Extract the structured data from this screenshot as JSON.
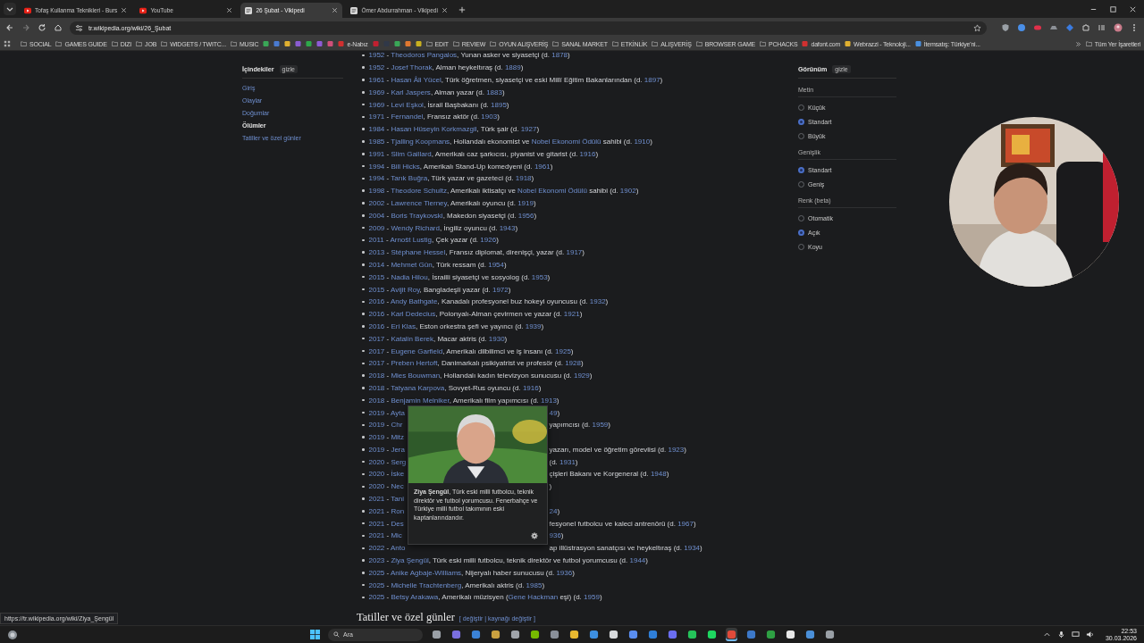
{
  "browser": {
    "tabs": [
      {
        "title": "Tofaş Kullanma Teknikleri - Burs",
        "kind": "video",
        "selected": false
      },
      {
        "title": "YouTube",
        "kind": "video",
        "selected": false
      },
      {
        "title": "26 Şubat - Vikipedi",
        "kind": "wiki",
        "selected": true
      },
      {
        "title": "Ömer Abdurrahman - Vikipedi",
        "kind": "wiki",
        "selected": false
      }
    ],
    "url": "tr.wikipedia.org/wiki/26_Şubat",
    "bookmarks": [
      {
        "kind": "folder",
        "label": "SOCIAL"
      },
      {
        "kind": "folder",
        "label": "GAMES GUIDE"
      },
      {
        "kind": "folder",
        "label": "DIZI"
      },
      {
        "kind": "folder",
        "label": "JOB"
      },
      {
        "kind": "folder",
        "label": "WIDGETS / TWITC..."
      },
      {
        "kind": "folder",
        "label": "MUSIC"
      },
      {
        "kind": "site",
        "color": "#3aa757"
      },
      {
        "kind": "site",
        "color": "#4a7bd0"
      },
      {
        "kind": "site",
        "color": "#e0b030"
      },
      {
        "kind": "site",
        "color": "#8a5cd0"
      },
      {
        "kind": "site",
        "color": "#2ea84a"
      },
      {
        "kind": "site",
        "color": "#8e5bd6"
      },
      {
        "kind": "site",
        "color": "#d0507a"
      },
      {
        "kind": "site",
        "color": "#d03030",
        "label": "e-Nabız"
      },
      {
        "kind": "site",
        "color": "#c02030"
      },
      {
        "kind": "site",
        "color": "#303848"
      },
      {
        "kind": "site",
        "color": "#3aa757"
      },
      {
        "kind": "site",
        "color": "#e07830"
      },
      {
        "kind": "site",
        "color": "#c8b020"
      },
      {
        "kind": "folder",
        "label": "EDIT"
      },
      {
        "kind": "folder",
        "label": "REVIEW"
      },
      {
        "kind": "folder",
        "label": "OYUN ALIŞVERİŞ"
      },
      {
        "kind": "folder",
        "label": "SANAL MARKET"
      },
      {
        "kind": "folder",
        "label": "ETKİNLİK"
      },
      {
        "kind": "folder",
        "label": "ALIŞVERİŞ"
      },
      {
        "kind": "folder",
        "label": "BROWSER GAME"
      },
      {
        "kind": "folder",
        "label": "PCHACKS"
      },
      {
        "kind": "site",
        "color": "#d03030",
        "label": "dafont.com"
      },
      {
        "kind": "site",
        "color": "#e0b030",
        "label": "Webrazzi - Teknoloji..."
      },
      {
        "kind": "site",
        "color": "#4a90e0",
        "label": "İtemsatış: Türkiye'ni..."
      }
    ],
    "all_bookmarks": "Tüm Yer İşaretleri"
  },
  "toc": {
    "title": "İçindekiler",
    "hide": "gizle",
    "items": [
      {
        "label": "Giriş",
        "selected": false
      },
      {
        "label": "Olaylar",
        "selected": false
      },
      {
        "label": "Doğumlar",
        "selected": false
      },
      {
        "label": "Ölümler",
        "selected": true
      },
      {
        "label": "Tatiller ve özel günler",
        "selected": false
      }
    ]
  },
  "deaths": [
    {
      "segs": [
        "1952",
        " - ",
        "Theodoros Pangalos",
        ", Yunan asker ve siyasetçi (d. ",
        "1878",
        ")"
      ]
    },
    {
      "segs": [
        "1952",
        " - ",
        "Josef Thorak",
        ", Alman heykeltıraş (d. ",
        "1889",
        ")"
      ]
    },
    {
      "segs": [
        "1961",
        " - ",
        "Hasan Âli Yücel",
        ", Türk öğretmen, siyasetçi ve eski Millî Eğitim Bakanlarından (d. ",
        "1897",
        ")"
      ]
    },
    {
      "segs": [
        "1969",
        " - ",
        "Karl Jaspers",
        ", Alman yazar (d. ",
        "1883",
        ")"
      ]
    },
    {
      "segs": [
        "1969",
        " - ",
        "Levi Eşkol",
        ", İsrail Başbakanı (d. ",
        "1895",
        ")"
      ]
    },
    {
      "segs": [
        "1971",
        " - ",
        "Fernandel",
        ", Fransız aktör (d. ",
        "1903",
        ")"
      ]
    },
    {
      "segs": [
        "1984",
        " - ",
        "Hasan Hüseyin Korkmazgil",
        ", Türk şair (d. ",
        "1927",
        ")"
      ]
    },
    {
      "segs": [
        "1985",
        " - ",
        "Tjalling Koopmans",
        ", Hollandalı ekonomist ve ",
        "Nobel Ekonomi Ödülü",
        " sahibi (d. ",
        "1910",
        ")"
      ]
    },
    {
      "segs": [
        "1991",
        " - ",
        "Slim Gaillard",
        ", Amerikalı caz şarkıcısı, piyanist ve gitarist (d. ",
        "1916",
        ")"
      ]
    },
    {
      "segs": [
        "1994",
        " - ",
        "Bill Hicks",
        ", Amerikalı Stand-Up komedyeni (d. ",
        "1961",
        ")"
      ]
    },
    {
      "segs": [
        "1994",
        " - ",
        "Tarık Buğra",
        ", Türk yazar ve gazeteci (d. ",
        "1918",
        ")"
      ]
    },
    {
      "segs": [
        "1998",
        " - ",
        "Theodore Schultz",
        ", Amerikalı iktisatçı ve ",
        "Nobel Ekonomi Ödülü",
        " sahibi (d. ",
        "1902",
        ")"
      ]
    },
    {
      "segs": [
        "2002",
        " - ",
        "Lawrence Tierney",
        ", Amerikalı oyuncu (d. ",
        "1919",
        ")"
      ]
    },
    {
      "segs": [
        "2004",
        " - ",
        "Boris Traykovski",
        ", Makedon siyasetçi (d. ",
        "1956",
        ")"
      ]
    },
    {
      "segs": [
        "2009",
        " - ",
        "Wendy Richard",
        ", İngiliz oyuncu (d. ",
        "1943",
        ")"
      ]
    },
    {
      "segs": [
        "2011",
        " - ",
        "Arnošt Lustig",
        ", Çek yazar (d. ",
        "1926",
        ")"
      ]
    },
    {
      "segs": [
        "2013",
        " - ",
        "Stéphane Hessel",
        ", Fransız diplomat, direnişçi, yazar (d. ",
        "1917",
        ")"
      ]
    },
    {
      "segs": [
        "2014",
        " - ",
        "Mehmet Gün",
        ", Türk ressam (d. ",
        "1954",
        ")"
      ]
    },
    {
      "segs": [
        "2015",
        " - ",
        "Nadia Hilou",
        ", İsrailli siyasetçi ve sosyolog (d. ",
        "1953",
        ")"
      ]
    },
    {
      "segs": [
        "2015",
        " - ",
        "Avijit Roy",
        ", Bangladeşli yazar (d. ",
        "1972",
        ")"
      ]
    },
    {
      "segs": [
        "2016",
        " - ",
        "Andy Bathgate",
        ", Kanadalı profesyonel buz hokeyi oyuncusu (d. ",
        "1932",
        ")"
      ]
    },
    {
      "segs": [
        "2016",
        " - ",
        "Karl Dedecius",
        ", Polonyalı-Alman çevirmen ve yazar (d. ",
        "1921",
        ")"
      ]
    },
    {
      "segs": [
        "2016",
        " - ",
        "Eri Klas",
        ", Eston orkestra şefi ve yayıncı (d. ",
        "1939",
        ")"
      ]
    },
    {
      "segs": [
        "2017",
        " - ",
        "Katalin Berek",
        ", Macar aktris (d. ",
        "1930",
        ")"
      ]
    },
    {
      "segs": [
        "2017",
        " - ",
        "Eugene Garfield",
        ", Amerikalı dilbilimci ve iş insanı (d. ",
        "1925",
        ")"
      ]
    },
    {
      "segs": [
        "2017",
        " - ",
        "Preben Hertoft",
        ", Danimarkalı psikiyatrist ve profesör (d. ",
        "1928",
        ")"
      ]
    },
    {
      "segs": [
        "2018",
        " - ",
        "Mies Bouwman",
        ", Hollandalı kadın televizyon sunucusu (d. ",
        "1929",
        ")"
      ]
    },
    {
      "segs": [
        "2018",
        " - ",
        "Tatyana Karpova",
        ", Sovyet-Rus oyuncu (d. ",
        "1916",
        ")"
      ]
    },
    {
      "segs": [
        "2018",
        " - ",
        "Benjamin Melniker",
        ", Amerikalı film yapımcısı (d. ",
        "1913",
        ")"
      ]
    },
    {
      "segs": [
        "2019",
        " - ",
        "Ayta"
      ],
      "after": [
        {
          "text": "49",
          "link": true
        },
        {
          "text": ")",
          "link": false
        }
      ]
    },
    {
      "segs": [
        "2019",
        " - ",
        "Chr"
      ],
      "after": [
        {
          "text": "yapımcısı (d. ",
          "link": false
        },
        {
          "text": "1959",
          "link": true
        },
        {
          "text": ")",
          "link": false
        }
      ]
    },
    {
      "segs": [
        "2019",
        " - ",
        "Mitz"
      ]
    },
    {
      "segs": [
        "2019",
        " - ",
        "Jera"
      ],
      "after": [
        {
          "text": "yazarı, model ve öğretim görevlisi (d. ",
          "link": false
        },
        {
          "text": "1923",
          "link": true
        },
        {
          "text": ")",
          "link": false
        }
      ]
    },
    {
      "segs": [
        "2020",
        " - ",
        "Serg"
      ],
      "after": [
        {
          "text": "(d. ",
          "link": false
        },
        {
          "text": "1931",
          "link": true
        },
        {
          "text": ")",
          "link": false
        }
      ]
    },
    {
      "segs": [
        "2020",
        " - ",
        "İske"
      ],
      "after": [
        {
          "text": "çişleri Bakanı ve Korgeneral (d. ",
          "link": false
        },
        {
          "text": "1948",
          "link": true
        },
        {
          "text": ")",
          "link": false
        }
      ]
    },
    {
      "segs": [
        "2020",
        " - ",
        "Nec"
      ],
      "after": [
        {
          "text": ")",
          "link": false
        }
      ]
    },
    {
      "segs": [
        "2021",
        " - ",
        "Tani"
      ]
    },
    {
      "segs": [
        "2021",
        " - ",
        "Ron"
      ],
      "after": [
        {
          "text": "24",
          "link": true
        },
        {
          "text": ")",
          "link": false
        }
      ]
    },
    {
      "segs": [
        "2021",
        " - ",
        "Des"
      ],
      "after": [
        {
          "text": "fesyonel futbolcu ve kaleci antrenörü (d. ",
          "link": false
        },
        {
          "text": "1967",
          "link": true
        },
        {
          "text": ")",
          "link": false
        }
      ]
    },
    {
      "segs": [
        "2021",
        " - ",
        "Mic"
      ],
      "after": [
        {
          "text": "936",
          "link": true
        },
        {
          "text": ")",
          "link": false
        }
      ]
    },
    {
      "segs": [
        "2022",
        " - ",
        "Anto"
      ],
      "after": [
        {
          "text": "ap illüstrasyon sanatçısı ve heykeltıraş (d. ",
          "link": false
        },
        {
          "text": "1934",
          "link": true
        },
        {
          "text": ")",
          "link": false
        }
      ]
    },
    {
      "segs": [
        "2023",
        " - ",
        "Ziya Şengül",
        ", Türk eski milli futbolcu, teknik direktör ve futbol yorumcusu (d. ",
        "1944",
        ")"
      ]
    },
    {
      "segs": [
        "2025",
        " - ",
        "Anike Agbaje-Williams",
        ", Nijeryalı haber sunucusu (d. ",
        "1936",
        ")"
      ]
    },
    {
      "segs": [
        "2025",
        " - ",
        "Michelle Trachtenberg",
        ", Amerikalı aktris (d. ",
        "1985",
        ")"
      ]
    },
    {
      "segs": [
        "2025",
        " - ",
        "Betsy Arakawa",
        ", Amerikalı müzisyen (",
        "Gene Hackman",
        " eşi) (d. ",
        "1959",
        ")"
      ]
    }
  ],
  "popup": {
    "text": "**Ziya Şengül**, Türk eski milli futbolcu, teknik direktör ve futbol yorumcusu. Fenerbahçe ve Türkiye milli futbol takımının eski kaptanlarındandır."
  },
  "next_heading": {
    "title": "Tatiller ve özel günler",
    "edit_links": "[ değiştir | kaynağı değiştir ]"
  },
  "appearance": {
    "title": "Görünüm",
    "hide": "gizle",
    "groups": [
      {
        "label": "Metin",
        "options": [
          {
            "label": "Küçük",
            "selected": false
          },
          {
            "label": "Standart",
            "selected": true
          },
          {
            "label": "Büyük",
            "selected": false
          }
        ]
      },
      {
        "label": "Genişlik",
        "options": [
          {
            "label": "Standart",
            "selected": true
          },
          {
            "label": "Geniş",
            "selected": false
          }
        ]
      },
      {
        "label": "Renk (beta)",
        "options": [
          {
            "label": "Otomatik",
            "selected": false
          },
          {
            "label": "Açık",
            "selected": true
          },
          {
            "label": "Koyu",
            "selected": false
          }
        ]
      }
    ]
  },
  "status_url": "https://tr.wikipedia.org/wiki/Ziya_Şengül",
  "taskbar": {
    "search_placeholder": "Ara",
    "apps": [
      {
        "color": "#9aa0a6",
        "selected": false
      },
      {
        "color": "#7b6fe0",
        "selected": false
      },
      {
        "color": "#3b82d6",
        "selected": false
      },
      {
        "color": "#c9a040",
        "selected": false
      },
      {
        "color": "#a0a4aa",
        "selected": false
      },
      {
        "color": "#76b900",
        "selected": false
      },
      {
        "color": "#8a9099",
        "selected": false
      },
      {
        "color": "#e8b830",
        "selected": false
      },
      {
        "color": "#3d8fe0",
        "selected": false
      },
      {
        "color": "#d8dadc",
        "selected": false
      },
      {
        "color": "#5a8ef0",
        "selected": false
      },
      {
        "color": "#2f7fd8",
        "selected": false
      },
      {
        "color": "#6a6ef0",
        "selected": false
      },
      {
        "color": "#25c35a",
        "selected": false
      },
      {
        "color": "#1ed760",
        "selected": false
      },
      {
        "color": "#e04a3a",
        "selected": true
      },
      {
        "color": "#3c78c8",
        "selected": false
      },
      {
        "color": "#2ea043",
        "selected": false
      },
      {
        "color": "#e8e8e8",
        "selected": false
      },
      {
        "color": "#4a8fd8",
        "selected": false
      },
      {
        "color": "#9aa0a6",
        "selected": false
      }
    ],
    "time": "22:53",
    "date": "30.03.2026"
  }
}
